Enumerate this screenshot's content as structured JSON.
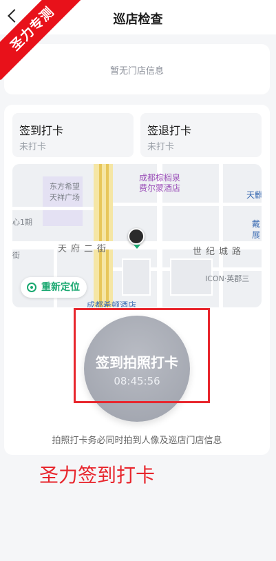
{
  "header": {
    "title": "巡店检查"
  },
  "ribbon": {
    "text": "圣力专测"
  },
  "store": {
    "empty_text": "暂无门店信息"
  },
  "checkin": {
    "sign_in": {
      "title": "签到打卡",
      "status": "未打卡"
    },
    "sign_out": {
      "title": "签退打卡",
      "status": "未打卡"
    }
  },
  "map": {
    "labels": {
      "l1": "东方希望",
      "l2": "天祥广场",
      "l3": "心1期",
      "l4": "街",
      "road1": "天府二街",
      "road2": "世纪城路",
      "poi1": "成都棕榈泉",
      "poi1b": "费尔蒙酒店",
      "poi2": "天麒",
      "poi3": "戴",
      "poi3b": "展",
      "l5": "ICON·英郡三",
      "l6": "成都希顿酒店"
    },
    "relocate_label": "重新定位"
  },
  "punch": {
    "label": "签到拍照打卡",
    "time": "08:45:56"
  },
  "hint": "拍照打卡务必同时拍到人像及巡店门店信息",
  "watermark": "圣力签到打卡",
  "colors": {
    "accent": "#19a870",
    "annotation": "#e8262d"
  }
}
